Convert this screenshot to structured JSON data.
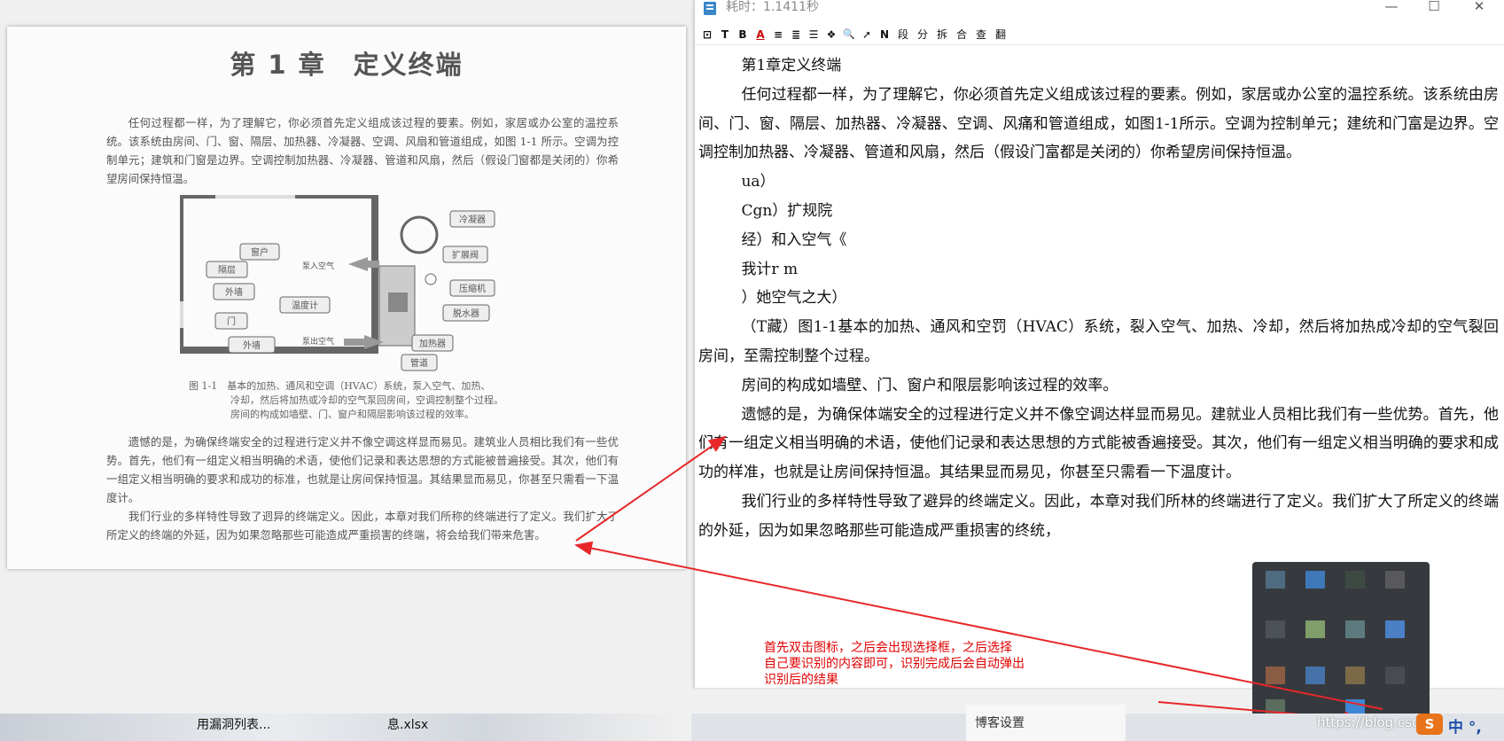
{
  "ocr_window": {
    "title": "耗时：1.1411秒",
    "controls": {
      "minimize": "—",
      "maximize": "☐",
      "close": "✕"
    },
    "toolbar": [
      "⊡",
      "T",
      "B",
      "A",
      "≡",
      "≣",
      "☰",
      "❖",
      "🔍",
      "➚",
      "N",
      "段",
      "分",
      "拆",
      "合",
      "查",
      "翻"
    ],
    "text_lines": [
      "第1章定义终端",
      "任何过程都一样，为了理解它，你必须首先定义组成该过程的要素。例如，家居或办公室的温控系统。该系统由房间、门、窗、隔层、加热器、冷凝器、空调、风痛和管道组成，如图1-1所示。空调为控制单元；建统和门富是边界。空调控制加热器、冷凝器、管道和风扇，然后（假设门富都是关闭的）你希望房间保持恒温。",
      "ua）",
      "Cgn）扩规院",
      "经）和入空气《",
      "我计r m",
      "）她空气之大）",
      "（T藏）图1-1基本的加热、通风和空罚（HVAC）系统，裂入空气、加热、冷却，然后将加热成冷却的空气裂回房间，至需控制整个过程。",
      "房间的构成如墙壁、门、窗户和限层影响该过程的效率。",
      "遗憾的是，为确保体端安全的过程进行定义并不像空调达样显而易见。建就业人员相比我们有一些优势。首先，他们有一组定义相当明确的术语，使他们记录和表达思想的方式能被香遍接受。其次，他们有一组定义相当明确的要求和成功的样准，也就是让房间保持恒温。其结果显而易见，你甚至只需看一下温度计。",
      "我们行业的多样特性导致了避异的终端定义。因此，本章对我们所林的终端进行了定义。我们扩大了所定义的终端的外延，因为如果忽略那些可能造成严重损害的终统，"
    ]
  },
  "scan_page": {
    "title": "第 1 章　定义终端",
    "para1": "任何过程都一样，为了理解它，你必须首先定义组成该过程的要素。例如，家居或办公室的温控系统。该系统由房间、门、窗、隔层、加热器、冷凝器、空调、风扇和管道组成，如图 1-1 所示。空调为控制单元；建筑和门窗是边界。空调控制加热器、冷凝器、管道和风扇，然后（假设门窗都是关闭的）你希望房间保持恒温。",
    "caption_lines": [
      "图 1-1　基本的加热、通风和空调（HVAC）系统，泵入空气、加热、",
      "冷却，然后将加热或冷却的空气泵回房间，空调控制整个过程。",
      "房间的构成如墙壁、门、窗户和隔层影响该过程的效率。"
    ],
    "para2": "遗憾的是，为确保终端安全的过程进行定义并不像空调这样显而易见。建筑业人员相比我们有一些优势。首先，他们有一组定义相当明确的术语，使他们记录和表达思想的方式能被普遍接受。其次，他们有一组定义相当明确的要求和成功的标准，也就是让房间保持恒温。其结果显而易见，你甚至只需看一下温度计。",
    "para3": "我们行业的多样特性导致了迥异的终端定义。因此，本章对我们所称的终端进行了定义。我们扩大了所定义的终端的外延，因为如果忽略那些可能造成严重损害的终端，将会给我们带来危害。",
    "diagram_labels": {
      "window": "窗户",
      "partition": "隔层",
      "outer_wall": "外墙",
      "door": "门",
      "outer_wall2": "外墙",
      "pump_in": "泵入空气",
      "thermometer": "温度计",
      "pump_out": "泵出空气",
      "condenser": "冷凝器",
      "expansion_valve": "扩展阀",
      "compressor": "压缩机",
      "water_pump": "脱水器",
      "heater": "加热器",
      "duct": "管道"
    }
  },
  "annotation": [
    "首先双击图标，之后会出现选择框，之后选择",
    "自己要识别的内容即可，识别完成后会自动弹出",
    "识别后的结果"
  ],
  "taskbar": {
    "item1": "用漏洞列表...",
    "item2": "息.xlsx",
    "blog_settings": "博客设置",
    "url_watermark": "https://blog.csdn",
    "ime_logo": "S",
    "ime_text": "中 °,"
  },
  "colors": {
    "annotation_red": "#e00000",
    "arrow_red": "#e8272a"
  }
}
